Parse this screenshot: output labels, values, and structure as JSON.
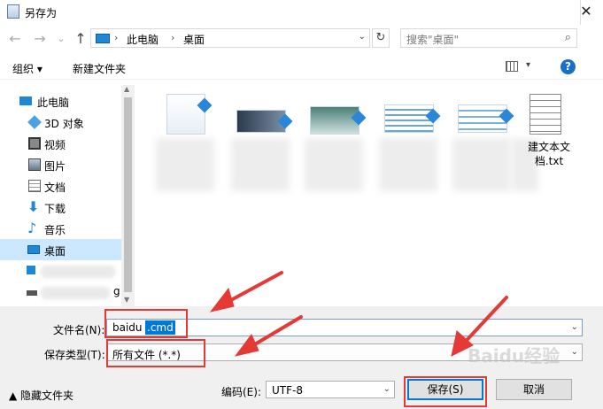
{
  "window": {
    "title": "另存为",
    "close_glyph": "✕"
  },
  "nav_buttons": {
    "back": "←",
    "forward": "→",
    "history": "⌄",
    "up": "↑"
  },
  "address": {
    "crumbs": [
      "此电脑",
      "桌面"
    ],
    "refresh_glyph": "↻"
  },
  "search": {
    "placeholder": "搜索\"桌面\""
  },
  "toolbar": {
    "organize": "组织 ▾",
    "new_folder": "新建文件夹",
    "help": "?"
  },
  "sidebar": {
    "items": [
      {
        "label": "此电脑",
        "icon": "computer-icon"
      },
      {
        "label": "3D 对象",
        "icon": "cube-icon"
      },
      {
        "label": "视频",
        "icon": "video-icon"
      },
      {
        "label": "图片",
        "icon": "picture-icon"
      },
      {
        "label": "文档",
        "icon": "document-icon"
      },
      {
        "label": "下载",
        "icon": "download-icon"
      },
      {
        "label": "音乐",
        "icon": "music-icon"
      },
      {
        "label": "桌面",
        "icon": "desktop-icon",
        "selected": true
      }
    ],
    "blurred_tail": [
      "g"
    ]
  },
  "files": {
    "items": [
      {
        "name": "",
        "kind": "word-doc"
      },
      {
        "name": "",
        "kind": "image"
      },
      {
        "name": "",
        "kind": "image"
      },
      {
        "name": "",
        "kind": "image"
      },
      {
        "name": "",
        "kind": "image"
      },
      {
        "name": "建文本文档.txt",
        "kind": "text"
      }
    ]
  },
  "form": {
    "filename_label": "文件名(N):",
    "filename_value_plain": "baidu",
    "filename_value_selected": ".cmd",
    "type_label": "保存类型(T):",
    "type_value": "所有文件 (*.*)",
    "encoding_label": "编码(E):",
    "encoding_value": "UTF-8",
    "hide_folders": "▲ 隐藏文件夹",
    "save": "保存(S)",
    "cancel": "取消"
  },
  "colors": {
    "accent": "#0078d7",
    "highlight": "#e53935",
    "selection": "#cce8ff"
  },
  "watermark": "Baidu经验"
}
